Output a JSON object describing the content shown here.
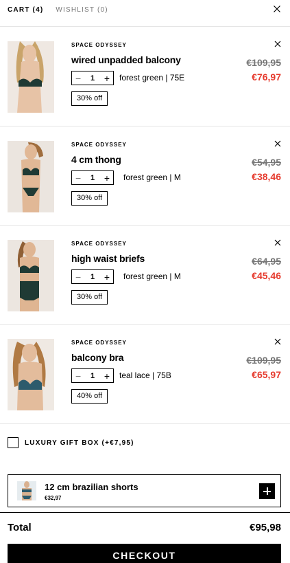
{
  "tabs": {
    "cart": "CART (4)",
    "wishlist": "WISHLIST (0)"
  },
  "items": [
    {
      "brand": "SPACE ODYSSEY",
      "name": "wired unpadded balcony",
      "qty": "1",
      "variant": "forest green | 75E",
      "discount": "30% off",
      "old_price": "€109,95",
      "new_price": "€76,97",
      "model": "green-bra"
    },
    {
      "brand": "SPACE ODYSSEY",
      "name": "4 cm thong",
      "qty": "1",
      "variant": "forest green | M",
      "discount": "30% off",
      "old_price": "€54,95",
      "new_price": "€38,46",
      "model": "green-set"
    },
    {
      "brand": "SPACE ODYSSEY",
      "name": "high waist briefs",
      "qty": "1",
      "variant": "forest green | M",
      "discount": "30% off",
      "old_price": "€64,95",
      "new_price": "€45,46",
      "model": "green-highwaist"
    },
    {
      "brand": "SPACE ODYSSEY",
      "name": "balcony bra",
      "qty": "1",
      "variant": "teal lace | 75B",
      "discount": "40% off",
      "old_price": "€109,95",
      "new_price": "€65,97",
      "model": "teal-bra"
    }
  ],
  "gift": {
    "label": "LUXURY GIFT BOX (+€7,95)",
    "checked": false
  },
  "upsell": {
    "name": "12 cm brazilian shorts",
    "price": "€32,97"
  },
  "totals": {
    "label": "Total",
    "value": "€95,98"
  },
  "checkout": {
    "label": "CHECKOUT"
  },
  "colors": {
    "sale": "#e63b2e",
    "strike": "#777777",
    "fabric_green": "#1f3a34",
    "fabric_teal": "#2d5b6c"
  }
}
